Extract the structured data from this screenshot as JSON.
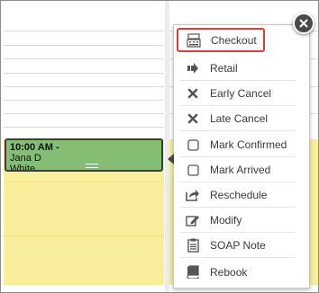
{
  "calendar": {
    "appointment": {
      "time": "10:00 AM -",
      "client_name": "Jana D",
      "client_name_2": "White"
    }
  },
  "context_menu": {
    "items": [
      {
        "label": "Checkout",
        "icon": "register-icon",
        "highlighted": true
      },
      {
        "label": "Retail",
        "icon": "arrow-right-icon"
      },
      {
        "label": "Early Cancel",
        "icon": "x-icon"
      },
      {
        "label": "Late Cancel",
        "icon": "x-icon"
      },
      {
        "label": "Mark Confirmed",
        "icon": "checkbox-icon"
      },
      {
        "label": "Mark Arrived",
        "icon": "checkbox-icon"
      },
      {
        "label": "Reschedule",
        "icon": "share-arrow-icon"
      },
      {
        "label": "Modify",
        "icon": "edit-icon"
      },
      {
        "label": "SOAP Note",
        "icon": "clipboard-icon"
      },
      {
        "label": "Rebook",
        "icon": "book-icon"
      }
    ],
    "close_icon": "close-icon"
  },
  "colors": {
    "appointment_bg": "#84be74",
    "slot_bg": "#f8ee9c",
    "highlight_border": "#e03c3c"
  }
}
